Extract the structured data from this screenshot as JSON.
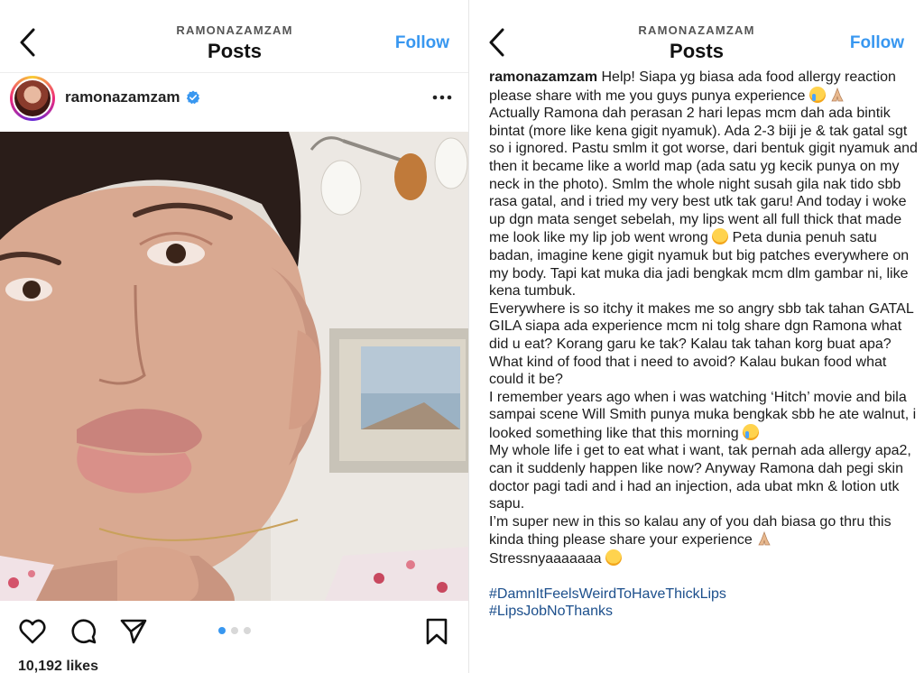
{
  "left_header": {
    "username": "RAMONAZAMZAM",
    "title": "Posts",
    "follow": "Follow"
  },
  "right_header": {
    "username": "RAMONAZAMZAM",
    "title": "Posts",
    "follow": "Follow"
  },
  "post": {
    "account": "ramonazamzam",
    "likes": "10,192 likes",
    "carousel_dots": 3,
    "carousel_active": 1
  },
  "caption": {
    "username": "ramonazamzam",
    "p1": "Help! Siapa yg biasa ada food allergy reaction please share with me you guys punya experience",
    "p2": "Actually Ramona dah perasan 2 hari lepas mcm dah ada bintik bintat (more like kena gigit nyamuk). Ada 2-3 biji je & tak gatal sgt so i ignored. Pastu smlm it got worse, dari bentuk gigit nyamuk and then it became like a world map (ada satu yg kecik punya on my neck in the photo). Smlm the whole night susah gila nak tido sbb rasa gatal, and i tried my very best utk tak garu! And today i woke up dgn mata senget sebelah, my lips went all full thick that made me look like my lip job went wrong",
    "p2b": "Peta dunia penuh satu badan, imagine kene gigit nyamuk but big patches everywhere on my body. Tapi kat muka dia jadi bengkak mcm dlm gambar ni, like kena tumbuk.",
    "p3": "Everywhere is so itchy it makes me so angry sbb tak tahan GATAL GILA siapa ada experience mcm ni tolg share dgn Ramona what did u eat? Korang garu ke tak? Kalau tak tahan korg buat apa? What kind of food that i need to avoid? Kalau bukan food what could it be?",
    "p4": "I remember years ago when i was watching ‘Hitch’ movie and bila sampai scene Will Smith punya muka bengkak sbb he ate walnut, i looked something like that this morning",
    "p5": "My whole life i get to eat what i want, tak pernah ada allergy apa2, can it suddenly happen like now? Anyway Ramona dah pegi skin doctor pagi tadi and i had an injection, ada ubat mkn & lotion utk sapu.",
    "p6": "I’m super new in this so kalau any of you dah biasa go thru this kinda thing please share your experience",
    "p7": "Stressnyaaaaaaa",
    "tag1": "#DamnItFeelsWeirdToHaveThickLips",
    "tag2": "#LipsJobNoThanks"
  },
  "icons": {
    "back": "chevron-left-icon",
    "verified": "verified-badge-icon",
    "more": "more-dots-icon",
    "like": "heart-icon",
    "comment": "comment-icon",
    "share": "send-icon",
    "save": "bookmark-icon"
  },
  "colors": {
    "follow": "#3897f0",
    "hashtag": "#1c4f8c",
    "verified": "#3897f0"
  }
}
